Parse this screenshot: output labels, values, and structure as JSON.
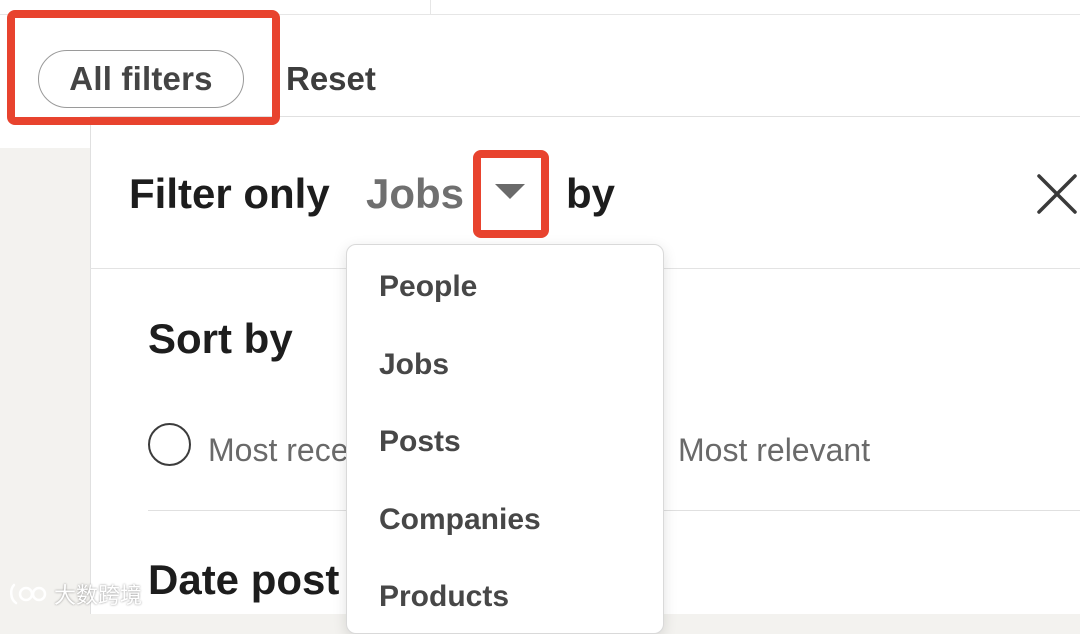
{
  "toolbar": {
    "all_filters_label": "All filters",
    "reset_label": "Reset"
  },
  "panel": {
    "filter_only_label": "Filter only",
    "selected_type": "Jobs",
    "by_label": "by",
    "sort_by_heading": "Sort by",
    "sort_options": [
      "Most rece",
      "Most relevant"
    ],
    "date_posted_heading": "Date post"
  },
  "dropdown": {
    "options": [
      "People",
      "Jobs",
      "Posts",
      "Companies",
      "Products"
    ]
  },
  "watermark": {
    "text": "大数跨境"
  },
  "colors": {
    "highlight": "#e8432e",
    "heading_text": "#1d1d1d",
    "muted_text": "#6f6f6f"
  },
  "icons": {
    "caret": "chevron-down-icon",
    "close": "close-icon"
  }
}
